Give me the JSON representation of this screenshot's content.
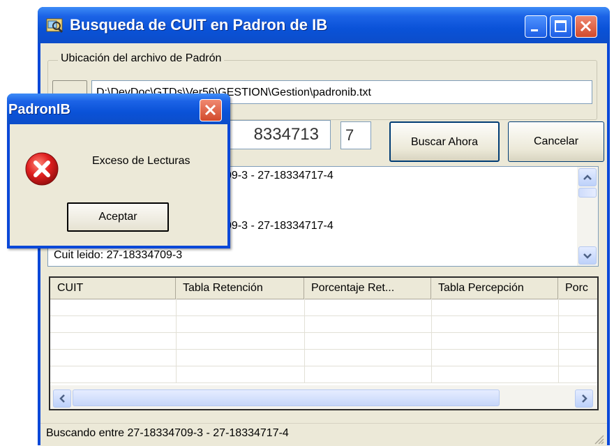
{
  "window": {
    "title": "Busqueda de CUIT en Padron de IB"
  },
  "file_group": {
    "legend": "Ubicación del archivo de Padrón",
    "path": "D:\\DevDoc\\GTDs\\Ver56\\GESTION\\Gestion\\padronib.txt"
  },
  "search": {
    "cuit_visible": "8334713",
    "check_digit": "7",
    "search_button": "Buscar Ahora",
    "cancel_button": "Cancelar"
  },
  "log": {
    "lines": [
      "09-3 - 27-18334717-4",
      "09-3 - 27-18334717-4",
      "Cuit leido: 27-18334709-3"
    ]
  },
  "grid": {
    "columns": [
      "CUIT",
      "Tabla Retención",
      "Porcentaje Ret...",
      "Tabla Percepción",
      "Porc"
    ]
  },
  "status": {
    "text": "Buscando entre 27-18334709-3 - 27-18334717-4"
  },
  "dialog": {
    "title": "PadronIB",
    "message": "Exceso de Lecturas",
    "ok_button": "Aceptar",
    "icon": "error-icon"
  },
  "colors": {
    "titlebar": "#0a52d8",
    "window_face": "#ece9d8",
    "close_button": "#d24a2c",
    "error_red": "#e02020"
  }
}
